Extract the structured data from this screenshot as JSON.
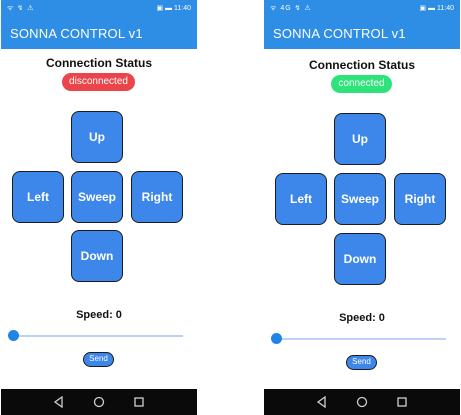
{
  "screens": [
    {
      "status_bar": {
        "left_text": "ᯤ ↯ ⚠",
        "right_text": "▣ ▬ 11:40"
      },
      "app_title": "SONNA CONTROL  v1",
      "connection_title": "Connection Status",
      "connection_badge": "disconnected",
      "buttons": {
        "up": "Up",
        "left": "Left",
        "sweep": "Sweep",
        "right": "Right",
        "down": "Down"
      },
      "speed_label": "Speed: 0",
      "speed_value": 0,
      "send_label": "Send"
    },
    {
      "status_bar": {
        "left_text": "ᯤ 4G ↯ ⚠",
        "right_text": "▣ ▬ 11:40"
      },
      "app_title": "SONNA CONTROL  v1",
      "connection_title": "Connection Status",
      "connection_badge": "connected",
      "buttons": {
        "up": "Up",
        "left": "Left",
        "sweep": "Sweep",
        "right": "Right",
        "down": "Down"
      },
      "speed_label": "Speed: 0",
      "speed_value": 0,
      "send_label": "Send"
    }
  ],
  "colors": {
    "app_bar": "#2e8ee6",
    "button": "#3d86ea",
    "disconnected_badge": "#e9454b",
    "connected_badge": "#2ee37a",
    "slider_track": "#b9d4f5",
    "slider_thumb": "#1f84e6"
  },
  "nav_icons": [
    "back-triangle-icon",
    "home-circle-icon",
    "recents-square-icon"
  ]
}
